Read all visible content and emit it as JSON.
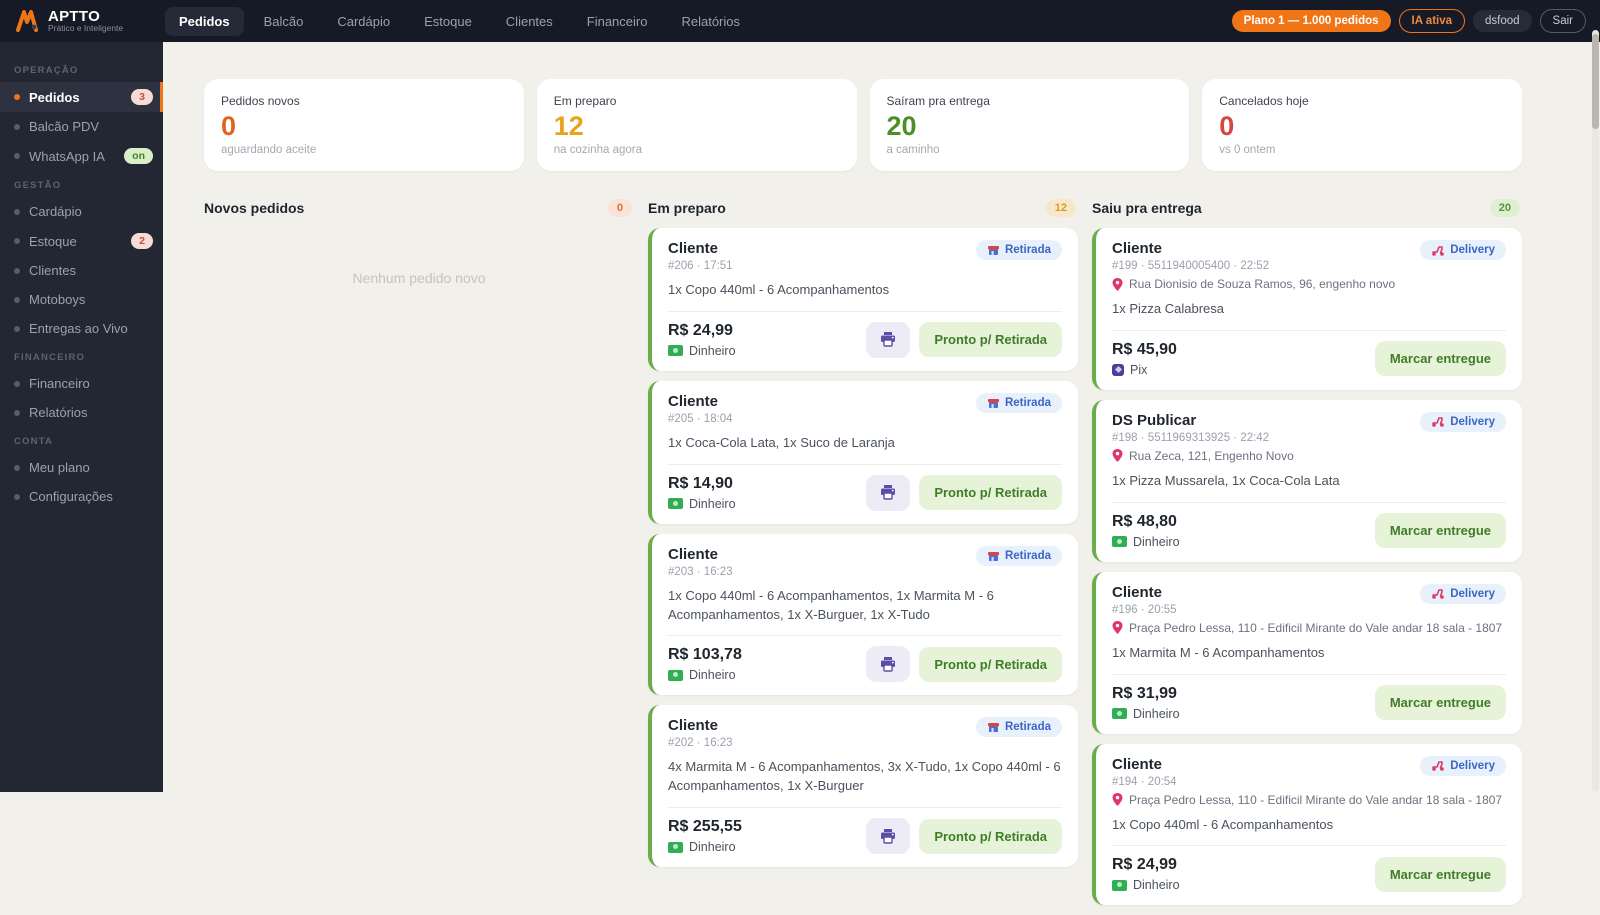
{
  "topbar": {
    "logo": "APTTO",
    "tagline": "Prático e Inteligente",
    "nav": [
      {
        "label": "Pedidos",
        "active": true
      },
      {
        "label": "Balcão",
        "active": false
      },
      {
        "label": "Cardápio",
        "active": false
      },
      {
        "label": "Estoque",
        "active": false
      },
      {
        "label": "Clientes",
        "active": false
      },
      {
        "label": "Financeiro",
        "active": false
      },
      {
        "label": "Relatórios",
        "active": false
      }
    ],
    "plan_badge": "Plano 1 — 1.000 pedidos",
    "ia_badge": "IA ativa",
    "store_badge": "dsfood",
    "logout_label": "Sair"
  },
  "sidebar": {
    "sections": [
      {
        "title": "OPERAÇÃO",
        "items": [
          {
            "label": "Pedidos",
            "active": true,
            "badge": "3",
            "badge_type": "count"
          },
          {
            "label": "Balcão PDV"
          },
          {
            "label": "WhatsApp IA",
            "badge": "on",
            "badge_type": "on"
          }
        ]
      },
      {
        "title": "GESTÃO",
        "items": [
          {
            "label": "Cardápio"
          },
          {
            "label": "Estoque",
            "badge": "2",
            "badge_type": "count"
          },
          {
            "label": "Clientes"
          },
          {
            "label": "Motoboys"
          },
          {
            "label": "Entregas ao Vivo"
          }
        ]
      },
      {
        "title": "FINANCEIRO",
        "items": [
          {
            "label": "Financeiro"
          },
          {
            "label": "Relatórios"
          }
        ]
      },
      {
        "title": "CONTA",
        "items": [
          {
            "label": "Meu plano"
          },
          {
            "label": "Configurações"
          }
        ]
      }
    ]
  },
  "stats": [
    {
      "label": "Pedidos novos",
      "value": "0",
      "sub": "aguardando aceite",
      "color": "#e2641c"
    },
    {
      "label": "Em preparo",
      "value": "12",
      "sub": "na cozinha agora",
      "color": "#e8a21d"
    },
    {
      "label": "Saíram pra entrega",
      "value": "20",
      "sub": "a caminho",
      "color": "#4b8f27"
    },
    {
      "label": "Cancelados hoje",
      "value": "0",
      "sub": "vs 0 ontem",
      "color": "#d64541"
    }
  ],
  "board": {
    "columns": [
      {
        "title": "Novos pedidos",
        "count": "0",
        "count_style": "new",
        "empty_text": "Nenhum pedido novo",
        "orders": []
      },
      {
        "title": "Em preparo",
        "count": "12",
        "count_style": "prep",
        "orders": [
          {
            "name": "Cliente",
            "meta": "#206  · 17:51",
            "badge": "Retirada",
            "badge_icon": "storefront-icon",
            "items": "1x Copo 440ml - 6 Acompanhamentos",
            "price": "R$ 24,99",
            "payment": "Dinheiro",
            "payment_icon": "cash-icon",
            "print": true,
            "primary_action": "Pronto p/ Retirada"
          },
          {
            "name": "Cliente",
            "meta": "#205  · 18:04",
            "badge": "Retirada",
            "badge_icon": "storefront-icon",
            "items": "1x Coca-Cola Lata, 1x Suco de Laranja",
            "price": "R$ 14,90",
            "payment": "Dinheiro",
            "payment_icon": "cash-icon",
            "print": true,
            "primary_action": "Pronto p/ Retirada"
          },
          {
            "name": "Cliente",
            "meta": "#203  · 16:23",
            "badge": "Retirada",
            "badge_icon": "storefront-icon",
            "items": "1x Copo 440ml - 6 Acompanhamentos, 1x Marmita M - 6 Acompanhamentos, 1x X-Burguer, 1x X-Tudo",
            "price": "R$ 103,78",
            "payment": "Dinheiro",
            "payment_icon": "cash-icon",
            "print": true,
            "primary_action": "Pronto p/ Retirada"
          },
          {
            "name": "Cliente",
            "meta": "#202  · 16:23",
            "badge": "Retirada",
            "badge_icon": "storefront-icon",
            "items": "4x Marmita M - 6 Acompanhamentos, 3x X-Tudo, 1x Copo 440ml - 6 Acompanhamentos, 1x X-Burguer",
            "price": "R$ 255,55",
            "payment": "Dinheiro",
            "payment_icon": "cash-icon",
            "print": true,
            "primary_action": "Pronto p/ Retirada"
          }
        ]
      },
      {
        "title": "Saiu pra entrega",
        "count": "20",
        "count_style": "out",
        "orders": [
          {
            "name": "Cliente",
            "meta": "#199 · 5511940005400  · 22:52",
            "badge": "Delivery",
            "badge_icon": "scooter-icon",
            "address": "Rua Dionisio de Souza Ramos, 96, engenho novo",
            "items": "1x Pizza Calabresa",
            "price": "R$ 45,90",
            "payment": "Pix",
            "payment_icon": "pix-icon",
            "print": false,
            "primary_action": "Marcar entregue"
          },
          {
            "name": "DS Publicar",
            "meta": "#198 · 5511969313925  · 22:42",
            "badge": "Delivery",
            "badge_icon": "scooter-icon",
            "address": "Rua Zeca, 121, Engenho Novo",
            "items": "1x Pizza Mussarela, 1x Coca-Cola Lata",
            "price": "R$ 48,80",
            "payment": "Dinheiro",
            "payment_icon": "cash-icon",
            "print": false,
            "primary_action": "Marcar entregue"
          },
          {
            "name": "Cliente",
            "meta": "#196  · 20:55",
            "badge": "Delivery",
            "badge_icon": "scooter-icon",
            "address": "Praça Pedro Lessa, 110 - Edificil Mirante do Vale andar 18 sala - 1807",
            "items": "1x Marmita M - 6 Acompanhamentos",
            "price": "R$ 31,99",
            "payment": "Dinheiro",
            "payment_icon": "cash-icon",
            "print": false,
            "primary_action": "Marcar entregue"
          },
          {
            "name": "Cliente",
            "meta": "#194  · 20:54",
            "badge": "Delivery",
            "badge_icon": "scooter-icon",
            "address": "Praça Pedro Lessa, 110 - Edificil Mirante do Vale andar 18 sala - 1807",
            "items": "1x Copo 440ml - 6 Acompanhamentos",
            "price": "R$ 24,99",
            "payment": "Dinheiro",
            "payment_icon": "cash-icon",
            "print": false,
            "primary_action": "Marcar entregue"
          }
        ]
      }
    ]
  }
}
